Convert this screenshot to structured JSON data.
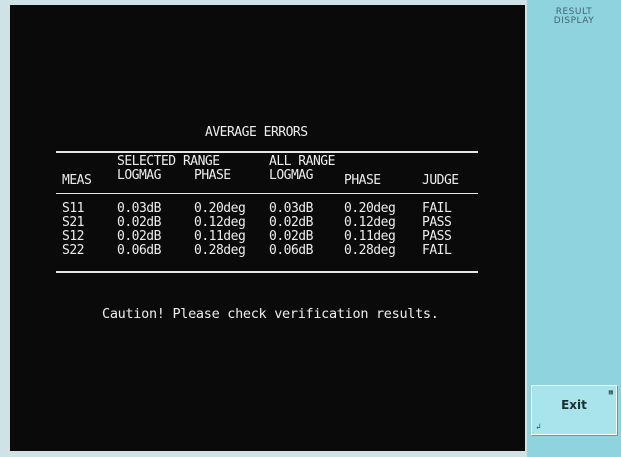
{
  "softkeys": {
    "menu_title_line1": "RESULT",
    "menu_title_line2": "DISPLAY",
    "exit_label": "Exit"
  },
  "result": {
    "title": "AVERAGE ERRORS",
    "group_headers": {
      "selected_range": "SELECTED RANGE",
      "all_range": "ALL RANGE"
    },
    "column_headers": {
      "meas": "MEAS",
      "sel_logmag": "LOGMAG",
      "sel_phase": "PHASE",
      "all_logmag": "LOGMAG",
      "all_phase": "PHASE",
      "judge": "JUDGE"
    },
    "rows": [
      {
        "meas": "S11",
        "sel_logmag": "0.03dB",
        "sel_phase": "0.20deg",
        "all_logmag": "0.03dB",
        "all_phase": "0.20deg",
        "judge": "FAIL"
      },
      {
        "meas": "S21",
        "sel_logmag": "0.02dB",
        "sel_phase": "0.12deg",
        "all_logmag": "0.02dB",
        "all_phase": "0.12deg",
        "judge": "PASS"
      },
      {
        "meas": "S12",
        "sel_logmag": "0.02dB",
        "sel_phase": "0.11deg",
        "all_logmag": "0.02dB",
        "all_phase": "0.11deg",
        "judge": "PASS"
      },
      {
        "meas": "S22",
        "sel_logmag": "0.06dB",
        "sel_phase": "0.28deg",
        "all_logmag": "0.06dB",
        "all_phase": "0.28deg",
        "judge": "FAIL"
      }
    ],
    "caution": "Caution! Please check verification results."
  }
}
